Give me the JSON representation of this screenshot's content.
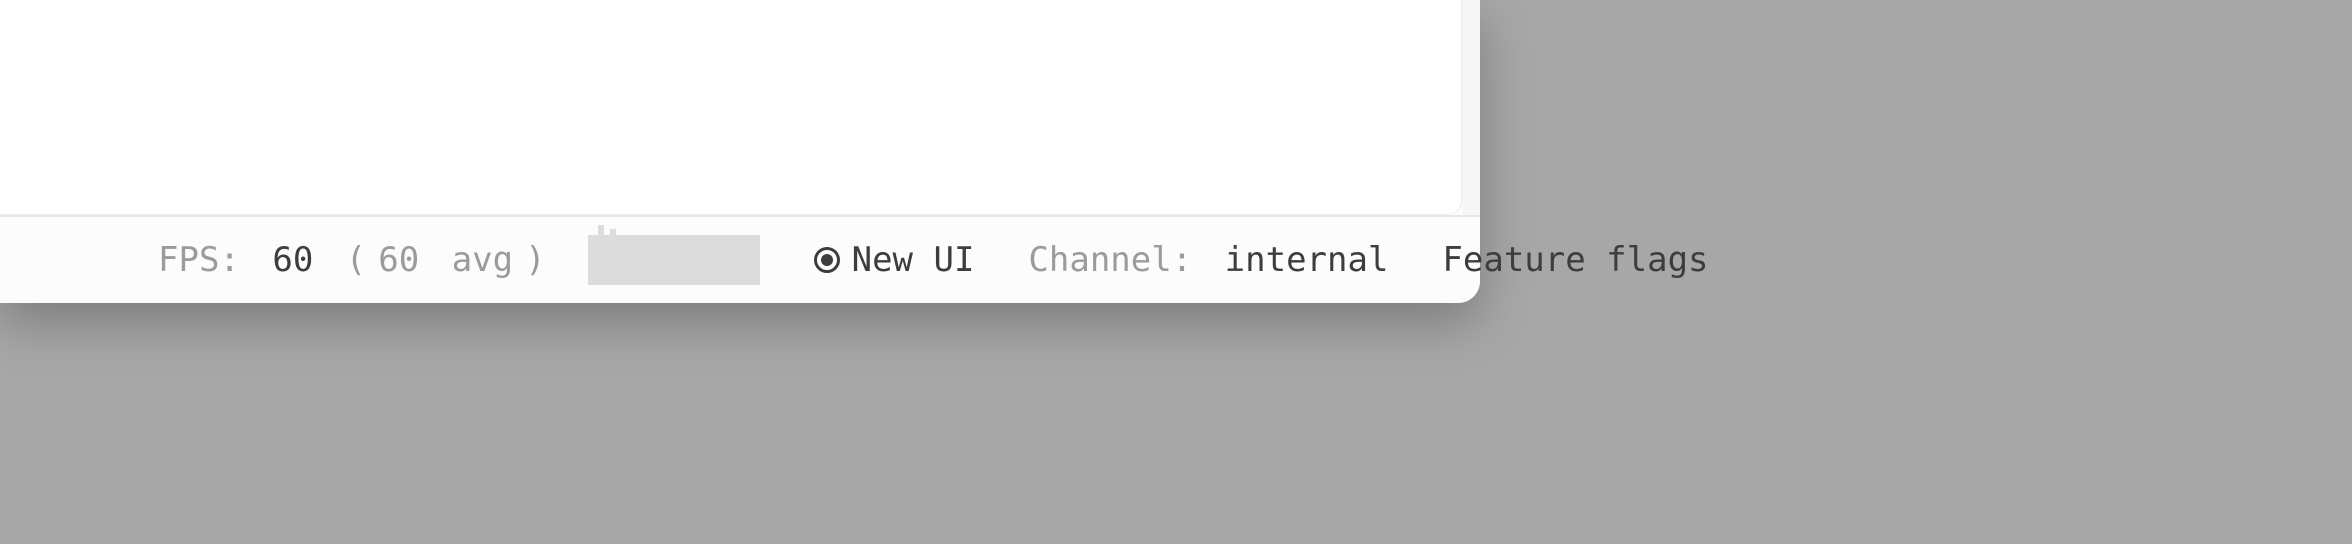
{
  "statusbar": {
    "fps": {
      "label": "FPS: ",
      "value": "60",
      "avg_open": " (",
      "avg_value": "60",
      "avg_label": " avg",
      "avg_close": ")"
    },
    "new_ui": {
      "label": "New UI"
    },
    "channel": {
      "label": "Channel: ",
      "value": "internal"
    },
    "feature_flags": {
      "label": "Feature flags"
    }
  }
}
